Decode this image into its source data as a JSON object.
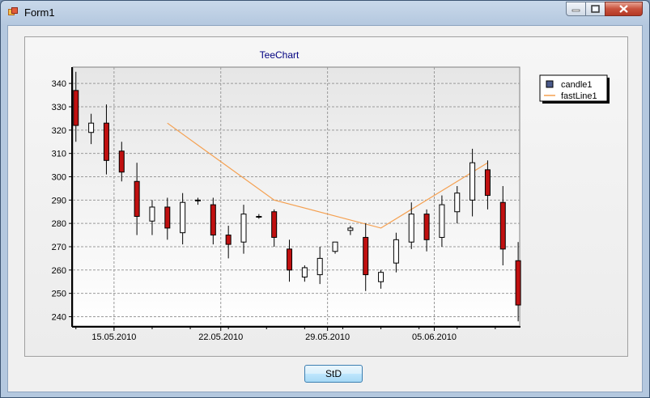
{
  "window": {
    "title": "Form1"
  },
  "buttons": {
    "std_label": "StD"
  },
  "chart_data": {
    "type": "candlestick",
    "title": "TeeChart",
    "ylim": [
      236,
      347
    ],
    "yticks": [
      240,
      250,
      260,
      270,
      280,
      290,
      300,
      310,
      320,
      330,
      340
    ],
    "xticks": [
      {
        "label": "15.05.2010",
        "day": 15
      },
      {
        "label": "22.05.2010",
        "day": 22
      },
      {
        "label": "29.05.2010",
        "day": 29
      },
      {
        "label": "05.06.2010",
        "day": 36
      }
    ],
    "xlim_days": [
      12.3,
      41.6
    ],
    "grid": true,
    "legend": {
      "position": "top-right",
      "items": [
        "candle1",
        "fastLine1"
      ]
    },
    "series": [
      {
        "name": "candle1",
        "type": "candle",
        "up_color": "#ffffff",
        "down_color": "#c01010",
        "candles": [
          {
            "day": 12.5,
            "open": 337,
            "high": 345,
            "low": 315,
            "close": 322
          },
          {
            "day": 13.5,
            "open": 319,
            "high": 327,
            "low": 314,
            "close": 323
          },
          {
            "day": 14.5,
            "open": 323,
            "high": 331,
            "low": 301,
            "close": 307
          },
          {
            "day": 15.5,
            "open": 311,
            "high": 315,
            "low": 298,
            "close": 302
          },
          {
            "day": 16.5,
            "open": 298,
            "high": 306,
            "low": 275,
            "close": 283
          },
          {
            "day": 17.5,
            "open": 281,
            "high": 290,
            "low": 275,
            "close": 287
          },
          {
            "day": 18.5,
            "open": 287,
            "high": 291,
            "low": 273,
            "close": 278
          },
          {
            "day": 19.5,
            "open": 276,
            "high": 293,
            "low": 271,
            "close": 289
          },
          {
            "day": 20.5,
            "open": 290,
            "high": 291,
            "low": 288,
            "close": 290
          },
          {
            "day": 21.5,
            "open": 288,
            "high": 291,
            "low": 271,
            "close": 275
          },
          {
            "day": 22.5,
            "open": 275,
            "high": 279,
            "low": 265,
            "close": 271
          },
          {
            "day": 23.5,
            "open": 272,
            "high": 288,
            "low": 267,
            "close": 284
          },
          {
            "day": 24.5,
            "open": 283,
            "high": 284,
            "low": 282,
            "close": 283
          },
          {
            "day": 25.5,
            "open": 285,
            "high": 286,
            "low": 270,
            "close": 274
          },
          {
            "day": 26.5,
            "open": 269,
            "high": 273,
            "low": 255,
            "close": 260
          },
          {
            "day": 27.5,
            "open": 257,
            "high": 262,
            "low": 255,
            "close": 261
          },
          {
            "day": 28.5,
            "open": 258,
            "high": 270,
            "low": 254,
            "close": 265
          },
          {
            "day": 29.5,
            "open": 268,
            "high": 272,
            "low": 267,
            "close": 272
          },
          {
            "day": 30.5,
            "open": 277,
            "high": 279,
            "low": 275,
            "close": 278
          },
          {
            "day": 31.5,
            "open": 274,
            "high": 280,
            "low": 251,
            "close": 258
          },
          {
            "day": 32.5,
            "open": 255,
            "high": 260,
            "low": 252,
            "close": 259
          },
          {
            "day": 33.5,
            "open": 263,
            "high": 276,
            "low": 259,
            "close": 273
          },
          {
            "day": 34.5,
            "open": 272,
            "high": 289,
            "low": 269,
            "close": 284
          },
          {
            "day": 35.5,
            "open": 284,
            "high": 286,
            "low": 268,
            "close": 273
          },
          {
            "day": 36.5,
            "open": 274,
            "high": 292,
            "low": 270,
            "close": 288
          },
          {
            "day": 37.5,
            "open": 285,
            "high": 296,
            "low": 280,
            "close": 293
          },
          {
            "day": 38.5,
            "open": 290,
            "high": 312,
            "low": 283,
            "close": 306
          },
          {
            "day": 39.5,
            "open": 303,
            "high": 307,
            "low": 286,
            "close": 292
          },
          {
            "day": 40.5,
            "open": 289,
            "high": 296,
            "low": 262,
            "close": 269
          },
          {
            "day": 41.5,
            "open": 264,
            "high": 272,
            "low": 238,
            "close": 245
          }
        ]
      },
      {
        "name": "fastLine1",
        "type": "line",
        "color": "#f5a050",
        "points": [
          {
            "day": 18.5,
            "value": 323
          },
          {
            "day": 25.5,
            "value": 290
          },
          {
            "day": 32.5,
            "value": 278
          },
          {
            "day": 39.5,
            "value": 306
          }
        ]
      }
    ]
  }
}
